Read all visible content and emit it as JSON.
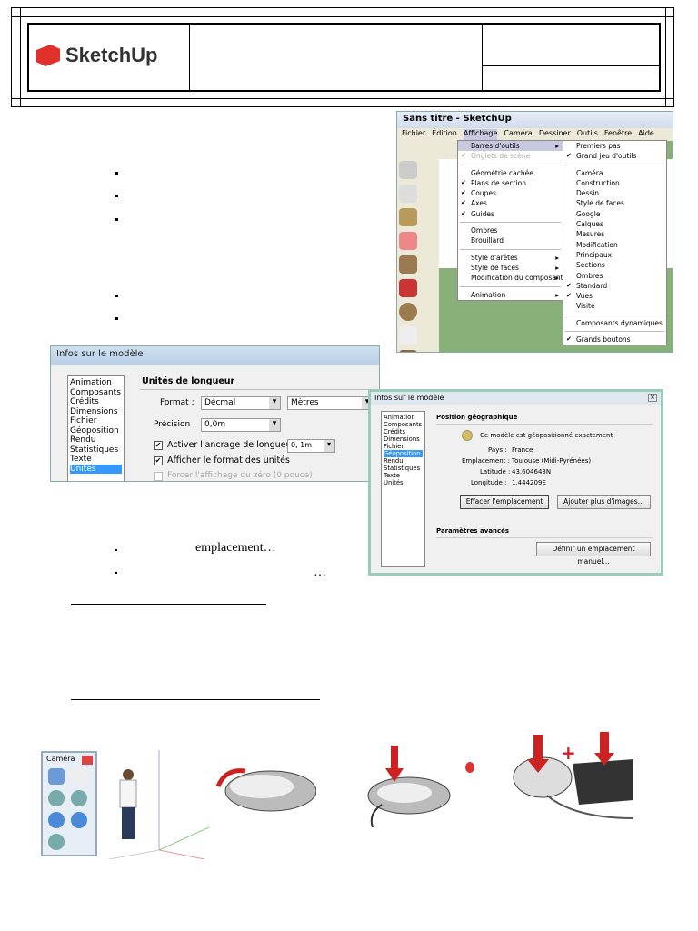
{
  "header": {
    "logo_text": "SketchUp"
  },
  "menu_window": {
    "title": "Sans titre - SketchUp",
    "menubar": [
      "Fichier",
      "Édition",
      "Affichage",
      "Caméra",
      "Dessiner",
      "Outils",
      "Fenêtre",
      "Aide"
    ],
    "affichage_menu": [
      {
        "label": "Barres d'outils",
        "state": "sel",
        "sub": true
      },
      {
        "label": "Onglets de scène",
        "state": "dis",
        "check": true
      },
      {
        "sep": true
      },
      {
        "label": "Géométrie cachée"
      },
      {
        "label": "Plans de section",
        "check": true
      },
      {
        "label": "Coupes",
        "check": true
      },
      {
        "label": "Axes",
        "check": true
      },
      {
        "label": "Guides",
        "check": true
      },
      {
        "sep": true
      },
      {
        "label": "Ombres"
      },
      {
        "label": "Brouillard"
      },
      {
        "sep": true
      },
      {
        "label": "Style d'arêtes",
        "sub": true
      },
      {
        "label": "Style de faces",
        "sub": true
      },
      {
        "label": "Modification du composant",
        "sub": true
      },
      {
        "sep": true
      },
      {
        "label": "Animation",
        "sub": true
      }
    ],
    "toolbars_menu": [
      {
        "label": "Premiers pas"
      },
      {
        "label": "Grand jeu d'outils",
        "check": true
      },
      {
        "sep": true
      },
      {
        "label": "Caméra"
      },
      {
        "label": "Construction"
      },
      {
        "label": "Dessin"
      },
      {
        "label": "Style de faces"
      },
      {
        "label": "Google"
      },
      {
        "label": "Calques"
      },
      {
        "label": "Mesures"
      },
      {
        "label": "Modification"
      },
      {
        "label": "Principaux"
      },
      {
        "label": "Sections"
      },
      {
        "label": "Ombres"
      },
      {
        "label": "Standard",
        "check": true
      },
      {
        "label": "Vues",
        "check": true
      },
      {
        "label": "Visite"
      },
      {
        "sep": true
      },
      {
        "label": "Composants dynamiques"
      },
      {
        "sep": true
      },
      {
        "label": "Grands boutons",
        "check": true
      }
    ]
  },
  "units_dialog": {
    "title": "Infos sur le modèle",
    "list": [
      "Animation",
      "Composants",
      "Crédits",
      "Dimensions",
      "Fichier",
      "Géoposition",
      "Rendu",
      "Statistiques",
      "Texte",
      "Unités"
    ],
    "selected": "Unités",
    "section": "Unités de longueur",
    "format_label": "Format :",
    "format_value": "Décmal",
    "unit_value": "Mètres",
    "precision_label": "Précision :",
    "precision_value": "0,0m",
    "snap_label": "Activer l'ancrage de longueur",
    "snap_value": "0, 1m",
    "show_format_label": "Afficher le format des unités",
    "force_zero_label": "Forcer l'affichage du zéro (0 pouce)"
  },
  "geo_dialog": {
    "title": "Infos sur le modèle",
    "list": [
      "Animation",
      "Composants",
      "Crédits",
      "Dimensions",
      "Fichier",
      "Géoposition",
      "Rendu",
      "Statistiques",
      "Texte",
      "Unités"
    ],
    "selected": "Géoposition",
    "section": "Position géographique",
    "status": "Ce modèle est géopositionné exactement",
    "pays_label": "Pays :",
    "pays": "France",
    "emplacement_label": "Emplacement :",
    "emplacement": "Toulouse (Midi-Pyrénées)",
    "latitude_label": "Latitude :",
    "latitude": "43.604643N",
    "longitude_label": "Longitude :",
    "longitude": "1.444209E",
    "clear_button": "Effacer l'emplacement",
    "add_images_button": "Ajouter plus d'images...",
    "advanced": "Paramètres avancés",
    "manual_button": "Définir un emplacement manuel..."
  },
  "body_text": {
    "bullet1": "emplacement…",
    "bullet2": "…"
  },
  "camera_toolbar": {
    "title": "Caméra"
  }
}
